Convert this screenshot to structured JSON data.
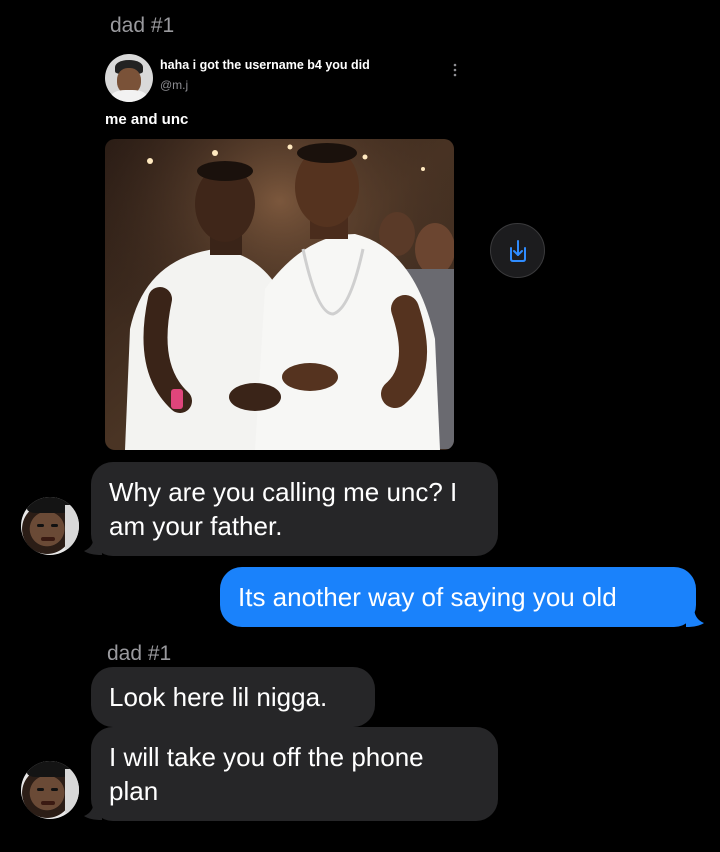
{
  "thread": {
    "sender_label_1": "dad #1",
    "sender_label_2": "dad #1"
  },
  "embed": {
    "author": "haha i got the username b4 you did",
    "handle": "@m.j",
    "text": "me and unc",
    "more_icon": "more-vertical-icon",
    "share_icon": "share-download-icon"
  },
  "messages": [
    {
      "direction": "incoming",
      "text": "Why are you calling me unc? I am your father."
    },
    {
      "direction": "outgoing",
      "text": "Its another way of saying you old"
    },
    {
      "direction": "incoming",
      "text": "Look here lil nigga."
    },
    {
      "direction": "incoming",
      "text": "I will take you off the phone plan"
    }
  ],
  "colors": {
    "background": "#000000",
    "incoming_bubble": "#262628",
    "outgoing_bubble": "#1a82fb",
    "label": "#9a9a9e",
    "share_icon": "#2f8cff"
  }
}
